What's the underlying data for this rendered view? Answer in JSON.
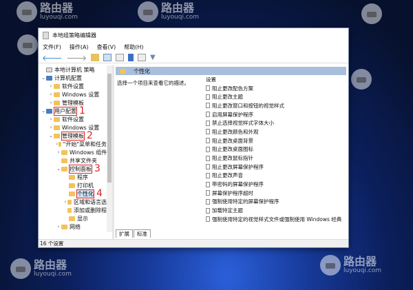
{
  "watermark": {
    "brand": "路由器",
    "url": "luyouqi.com"
  },
  "window": {
    "title": "本地组策略编辑器"
  },
  "menu": [
    "文件(F)",
    "操作(A)",
    "查看(V)",
    "帮助(H)"
  ],
  "tree": [
    {
      "label": "本地计算机 策略",
      "level": 0,
      "arrow": ""
    },
    {
      "label": "计算机配置",
      "level": 0,
      "arrow": "⌄"
    },
    {
      "label": "软件设置",
      "level": 1,
      "arrow": "›"
    },
    {
      "label": "Windows 设置",
      "level": 1,
      "arrow": "›"
    },
    {
      "label": "管理模板",
      "level": 1,
      "arrow": "›"
    },
    {
      "label": "用户配置",
      "level": 0,
      "arrow": "⌄",
      "mark": "1"
    },
    {
      "label": "软件设置",
      "level": 1,
      "arrow": "›"
    },
    {
      "label": "Windows 设置",
      "level": 1,
      "arrow": "›"
    },
    {
      "label": "管理模板",
      "level": 1,
      "arrow": "⌄",
      "mark": "2"
    },
    {
      "label": "\"开始\"菜单和任务栏",
      "level": 2,
      "arrow": "›"
    },
    {
      "label": "Windows 组件",
      "level": 2,
      "arrow": "›"
    },
    {
      "label": "共享文件夹",
      "level": 2,
      "arrow": ""
    },
    {
      "label": "控制面板",
      "level": 2,
      "arrow": "⌄",
      "mark": "3"
    },
    {
      "label": "程序",
      "level": 3,
      "arrow": ""
    },
    {
      "label": "打印机",
      "level": 3,
      "arrow": ""
    },
    {
      "label": "个性化",
      "level": 3,
      "arrow": "",
      "mark": "4",
      "selected": true
    },
    {
      "label": "区域和语言选项",
      "level": 3,
      "arrow": "›"
    },
    {
      "label": "添加或删除程序",
      "level": 3,
      "arrow": ""
    },
    {
      "label": "显示",
      "level": 3,
      "arrow": ""
    },
    {
      "label": "网络",
      "level": 2,
      "arrow": "›"
    }
  ],
  "right": {
    "header": "个性化",
    "description": "选择一个项目来查看它的描述。",
    "column": "设置",
    "settings": [
      "阻止更改配色方案",
      "阻止更改主题",
      "阻止更改窗口和按钮的视觉样式",
      "启用屏幕保护程序",
      "禁止选择视觉样式字体大小",
      "阻止更改颜色和外观",
      "阻止更改桌面背景",
      "阻止更改桌面图标",
      "阻止更改鼠标指针",
      "阻止更改屏幕保护程序",
      "阻止更改声音",
      "带密码的屏幕保护程序",
      "屏幕保护程序超时",
      "强制使用特定的屏幕保护程序",
      "加载特定主题",
      "强制使用特定的视觉样式文件或强制使用 Windows 经典"
    ]
  },
  "tabs": [
    "扩展",
    "标准"
  ],
  "status": "16 个设置"
}
